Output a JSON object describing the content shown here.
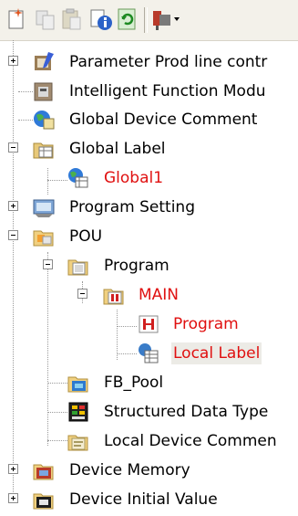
{
  "toolbar": {
    "buttons": [
      {
        "icon": "new-data-icon"
      },
      {
        "icon": "copy-icon"
      },
      {
        "icon": "paste-icon"
      },
      {
        "icon": "properties-icon"
      },
      {
        "icon": "refresh-icon"
      },
      {
        "icon": "display-filter-icon"
      }
    ]
  },
  "tree": {
    "items": [
      {
        "label": "Parameter Prod line contr",
        "icon": "parameter-icon"
      },
      {
        "label": "Intelligent Function Modu",
        "icon": "intelligent-module-icon"
      },
      {
        "label": "Global Device Comment",
        "icon": "device-comment-icon"
      },
      {
        "label": "Global Label",
        "icon": "global-label-folder-icon"
      },
      {
        "label": "Global1",
        "icon": "global-label-icon"
      },
      {
        "label": "Program Setting",
        "icon": "program-setting-icon"
      },
      {
        "label": "POU",
        "icon": "pou-folder-icon"
      },
      {
        "label": "Program",
        "icon": "program-folder-icon"
      },
      {
        "label": "MAIN",
        "icon": "program-block-icon"
      },
      {
        "label": "Program",
        "icon": "ladder-program-icon"
      },
      {
        "label": "Local Label",
        "icon": "local-label-icon"
      },
      {
        "label": "FB_Pool",
        "icon": "fb-pool-icon"
      },
      {
        "label": "Structured Data Type",
        "icon": "structured-data-icon"
      },
      {
        "label": "Local Device Commen",
        "icon": "local-device-comment-icon"
      },
      {
        "label": "Device Memory",
        "icon": "device-memory-icon"
      },
      {
        "label": "Device Initial Value",
        "icon": "device-initial-value-icon"
      }
    ]
  },
  "colors": {
    "modified_text": "#e01010",
    "selected_bg": "#ecebe6"
  }
}
